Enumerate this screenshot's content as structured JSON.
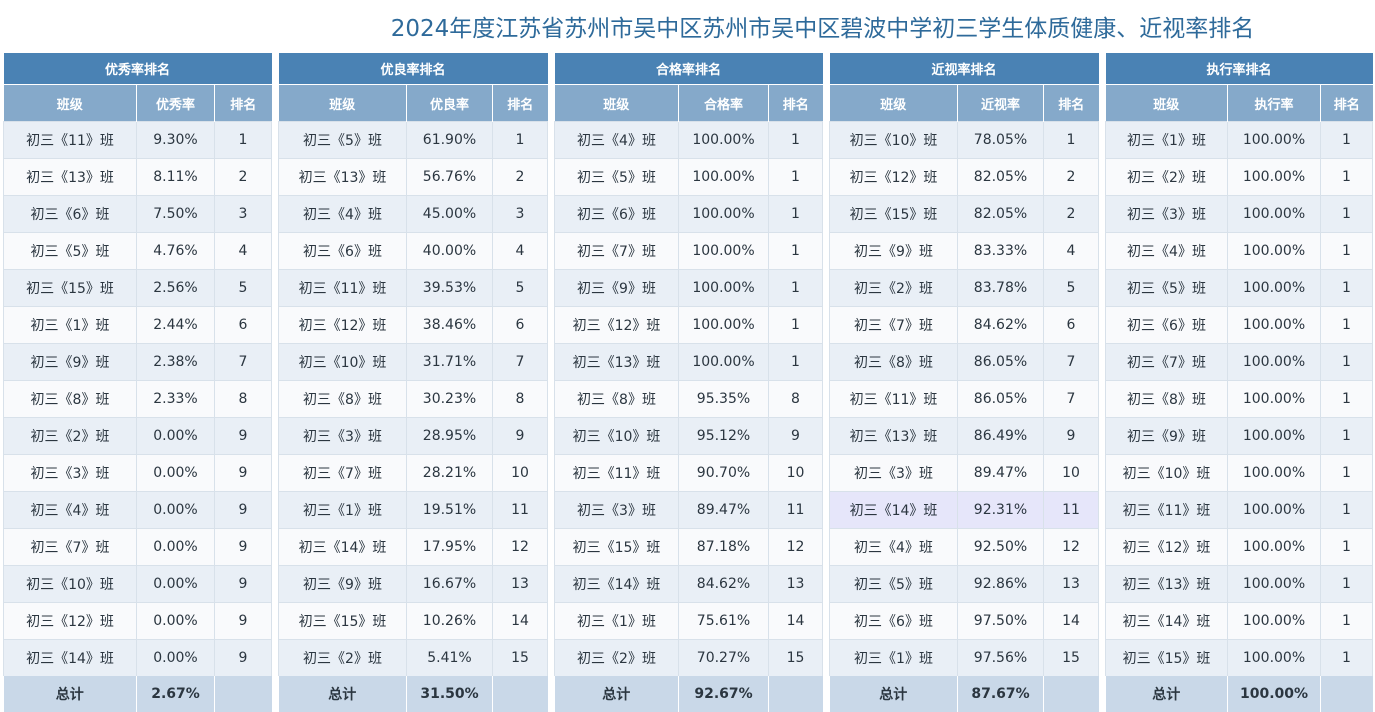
{
  "page": {
    "title": "2024年度江苏省苏州市吴中区苏州市吴中区碧波中学初三学生体质健康、近视率排名"
  },
  "colors": {
    "title_text": "#2e6a9a",
    "table_title_bg": "#4a82b4",
    "column_header_bg": "#85a9ca",
    "row_odd_bg": "#e9eff6",
    "row_even_bg": "#f9fafc",
    "footer_bg": "#c9d8e8",
    "highlight_row_bg": "#e6e6fa"
  },
  "tables": [
    {
      "title": "优秀率排名",
      "headers": [
        "班级",
        "优秀率",
        "排名"
      ],
      "rows": [
        [
          "初三《11》班",
          "9.30%",
          "1"
        ],
        [
          "初三《13》班",
          "8.11%",
          "2"
        ],
        [
          "初三《6》班",
          "7.50%",
          "3"
        ],
        [
          "初三《5》班",
          "4.76%",
          "4"
        ],
        [
          "初三《15》班",
          "2.56%",
          "5"
        ],
        [
          "初三《1》班",
          "2.44%",
          "6"
        ],
        [
          "初三《9》班",
          "2.38%",
          "7"
        ],
        [
          "初三《8》班",
          "2.33%",
          "8"
        ],
        [
          "初三《2》班",
          "0.00%",
          "9"
        ],
        [
          "初三《3》班",
          "0.00%",
          "9"
        ],
        [
          "初三《4》班",
          "0.00%",
          "9"
        ],
        [
          "初三《7》班",
          "0.00%",
          "9"
        ],
        [
          "初三《10》班",
          "0.00%",
          "9"
        ],
        [
          "初三《12》班",
          "0.00%",
          "9"
        ],
        [
          "初三《14》班",
          "0.00%",
          "9"
        ]
      ],
      "total": [
        "总计",
        "2.67%",
        ""
      ],
      "highlight_row": -1
    },
    {
      "title": "优良率排名",
      "headers": [
        "班级",
        "优良率",
        "排名"
      ],
      "rows": [
        [
          "初三《5》班",
          "61.90%",
          "1"
        ],
        [
          "初三《13》班",
          "56.76%",
          "2"
        ],
        [
          "初三《4》班",
          "45.00%",
          "3"
        ],
        [
          "初三《6》班",
          "40.00%",
          "4"
        ],
        [
          "初三《11》班",
          "39.53%",
          "5"
        ],
        [
          "初三《12》班",
          "38.46%",
          "6"
        ],
        [
          "初三《10》班",
          "31.71%",
          "7"
        ],
        [
          "初三《8》班",
          "30.23%",
          "8"
        ],
        [
          "初三《3》班",
          "28.95%",
          "9"
        ],
        [
          "初三《7》班",
          "28.21%",
          "10"
        ],
        [
          "初三《1》班",
          "19.51%",
          "11"
        ],
        [
          "初三《14》班",
          "17.95%",
          "12"
        ],
        [
          "初三《9》班",
          "16.67%",
          "13"
        ],
        [
          "初三《15》班",
          "10.26%",
          "14"
        ],
        [
          "初三《2》班",
          "5.41%",
          "15"
        ]
      ],
      "total": [
        "总计",
        "31.50%",
        ""
      ],
      "highlight_row": -1
    },
    {
      "title": "合格率排名",
      "headers": [
        "班级",
        "合格率",
        "排名"
      ],
      "rows": [
        [
          "初三《4》班",
          "100.00%",
          "1"
        ],
        [
          "初三《5》班",
          "100.00%",
          "1"
        ],
        [
          "初三《6》班",
          "100.00%",
          "1"
        ],
        [
          "初三《7》班",
          "100.00%",
          "1"
        ],
        [
          "初三《9》班",
          "100.00%",
          "1"
        ],
        [
          "初三《12》班",
          "100.00%",
          "1"
        ],
        [
          "初三《13》班",
          "100.00%",
          "1"
        ],
        [
          "初三《8》班",
          "95.35%",
          "8"
        ],
        [
          "初三《10》班",
          "95.12%",
          "9"
        ],
        [
          "初三《11》班",
          "90.70%",
          "10"
        ],
        [
          "初三《3》班",
          "89.47%",
          "11"
        ],
        [
          "初三《15》班",
          "87.18%",
          "12"
        ],
        [
          "初三《14》班",
          "84.62%",
          "13"
        ],
        [
          "初三《1》班",
          "75.61%",
          "14"
        ],
        [
          "初三《2》班",
          "70.27%",
          "15"
        ]
      ],
      "total": [
        "总计",
        "92.67%",
        ""
      ],
      "highlight_row": -1
    },
    {
      "title": "近视率排名",
      "headers": [
        "班级",
        "近视率",
        "排名"
      ],
      "rows": [
        [
          "初三《10》班",
          "78.05%",
          "1"
        ],
        [
          "初三《12》班",
          "82.05%",
          "2"
        ],
        [
          "初三《15》班",
          "82.05%",
          "2"
        ],
        [
          "初三《9》班",
          "83.33%",
          "4"
        ],
        [
          "初三《2》班",
          "83.78%",
          "5"
        ],
        [
          "初三《7》班",
          "84.62%",
          "6"
        ],
        [
          "初三《8》班",
          "86.05%",
          "7"
        ],
        [
          "初三《11》班",
          "86.05%",
          "7"
        ],
        [
          "初三《13》班",
          "86.49%",
          "9"
        ],
        [
          "初三《3》班",
          "89.47%",
          "10"
        ],
        [
          "初三《14》班",
          "92.31%",
          "11"
        ],
        [
          "初三《4》班",
          "92.50%",
          "12"
        ],
        [
          "初三《5》班",
          "92.86%",
          "13"
        ],
        [
          "初三《6》班",
          "97.50%",
          "14"
        ],
        [
          "初三《1》班",
          "97.56%",
          "15"
        ]
      ],
      "total": [
        "总计",
        "87.67%",
        ""
      ],
      "highlight_row": 10
    },
    {
      "title": "执行率排名",
      "headers": [
        "班级",
        "执行率",
        "排名"
      ],
      "rows": [
        [
          "初三《1》班",
          "100.00%",
          "1"
        ],
        [
          "初三《2》班",
          "100.00%",
          "1"
        ],
        [
          "初三《3》班",
          "100.00%",
          "1"
        ],
        [
          "初三《4》班",
          "100.00%",
          "1"
        ],
        [
          "初三《5》班",
          "100.00%",
          "1"
        ],
        [
          "初三《6》班",
          "100.00%",
          "1"
        ],
        [
          "初三《7》班",
          "100.00%",
          "1"
        ],
        [
          "初三《8》班",
          "100.00%",
          "1"
        ],
        [
          "初三《9》班",
          "100.00%",
          "1"
        ],
        [
          "初三《10》班",
          "100.00%",
          "1"
        ],
        [
          "初三《11》班",
          "100.00%",
          "1"
        ],
        [
          "初三《12》班",
          "100.00%",
          "1"
        ],
        [
          "初三《13》班",
          "100.00%",
          "1"
        ],
        [
          "初三《14》班",
          "100.00%",
          "1"
        ],
        [
          "初三《15》班",
          "100.00%",
          "1"
        ]
      ],
      "total": [
        "总计",
        "100.00%",
        ""
      ],
      "highlight_row": -1
    }
  ]
}
